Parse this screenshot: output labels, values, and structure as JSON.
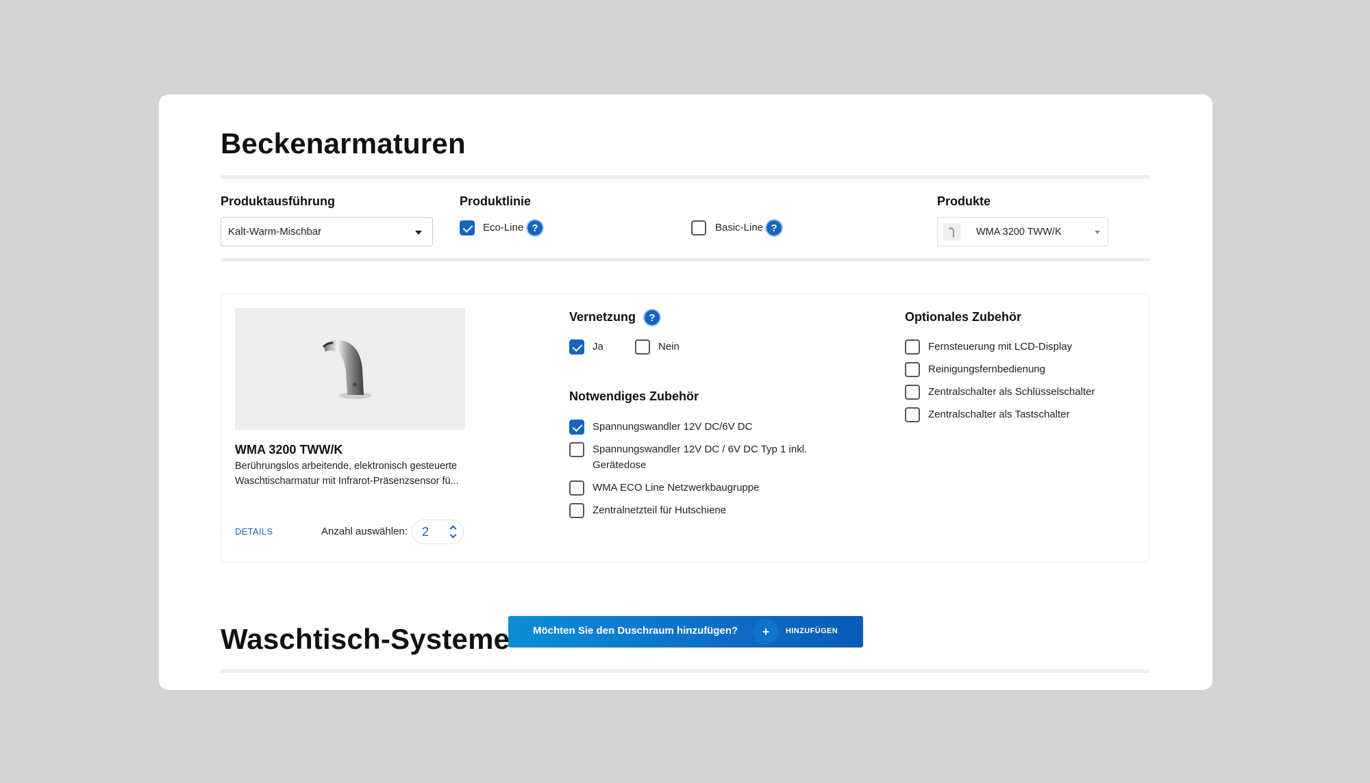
{
  "section1": {
    "title": "Beckenarmaturen",
    "produktausfuehrung": {
      "label": "Produktausführung",
      "value": "Kalt-Warm-Mischbar"
    },
    "produktlinie": {
      "label": "Produktlinie",
      "options": [
        {
          "label": "Eco-Line",
          "checked": true
        },
        {
          "label": "Basic-Line",
          "checked": false
        }
      ]
    },
    "produkte": {
      "label": "Produkte",
      "value": "WMA 3200 TWW/K"
    }
  },
  "product": {
    "name": "WMA 3200 TWW/K",
    "description": "Berührungslos arbeitende, elektronisch gesteuerte Waschtischarmatur mit Infrarot-Präsenzsensor fü...",
    "details_link": "DETAILS",
    "quantity_label": "Anzahl auswählen:",
    "quantity": "2"
  },
  "vernetzung": {
    "title": "Vernetzung",
    "options": [
      {
        "label": "Ja",
        "checked": true
      },
      {
        "label": "Nein",
        "checked": false
      }
    ]
  },
  "notwendiges": {
    "title": "Notwendiges Zubehör",
    "items": [
      {
        "label": "Spannungswandler 12V DC/6V DC",
        "checked": true
      },
      {
        "label": "Spannungswandler 12V DC / 6V DC Typ 1 inkl.",
        "label2": "Gerätedose",
        "checked": false
      },
      {
        "label": "WMA ECO Line Netzwerkbaugruppe",
        "checked": false
      },
      {
        "label": "Zentralnetzteil für Hutschiene",
        "checked": false
      }
    ]
  },
  "optional": {
    "title": "Optionales Zubehör",
    "items": [
      {
        "label": "Fernsteuerung mit LCD-Display",
        "checked": false
      },
      {
        "label": "Reinigungsfernbedienung",
        "checked": false
      },
      {
        "label": "Zentralschalter als Schlüsselschalter",
        "checked": false
      },
      {
        "label": "Zentralschalter als Tastschalter",
        "checked": false
      }
    ]
  },
  "section2": {
    "title": "Waschtisch-Systeme",
    "banner_text": "Möchten Sie den Duschraum hinzufügen?",
    "banner_plus": "+",
    "banner_button": "HINZUFÜGEN"
  },
  "help_symbol": "?",
  "colors": {
    "accent": "#1565c0",
    "background": "#d4d4d4",
    "card": "#ffffff"
  }
}
